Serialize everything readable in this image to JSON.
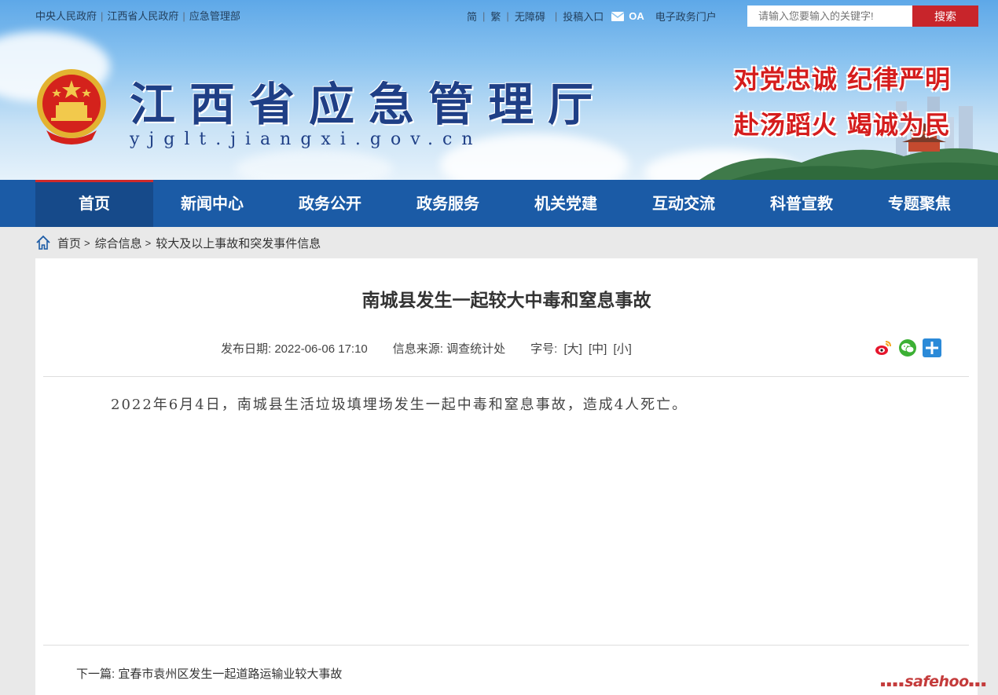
{
  "top_links": [
    "中央人民政府",
    "江西省人民政府",
    "应急管理部"
  ],
  "toolbar": {
    "simplified": "简",
    "traditional": "繁",
    "accessibility": "无障碍",
    "submit": "投稿入口",
    "oa": "OA",
    "egov": "电子政务门户"
  },
  "search": {
    "placeholder": "请输入您要输入的关键字!",
    "button": "搜索"
  },
  "site": {
    "title": "江西省应急管理厅",
    "domain": "yjglt.jiangxi.gov.cn",
    "slogan1": "对党忠诚 纪律严明",
    "slogan2": "赴汤蹈火 竭诚为民"
  },
  "nav": {
    "items": [
      "首页",
      "新闻中心",
      "政务公开",
      "政务服务",
      "机关党建",
      "互动交流",
      "科普宣教",
      "专题聚焦"
    ],
    "active_index": 0
  },
  "breadcrumb": {
    "home": "首页",
    "level1": "综合信息",
    "level2": "较大及以上事故和突发事件信息",
    "separator": ">"
  },
  "article": {
    "title": "南城县发生一起较大中毒和窒息事故",
    "date_label": "发布日期:",
    "date": "2022-06-06 17:10",
    "source_label": "信息来源:",
    "source": "调查统计处",
    "fontsize_label": "字号:",
    "font_large": "[大]",
    "font_medium": "[中]",
    "font_small": "[小]",
    "body": "2022年6月4日，南城县生活垃圾填埋场发生一起中毒和窒息事故，造成4人死亡。"
  },
  "next_article": {
    "label": "下一篇:",
    "title": "宜春市袁州区发生一起道路运输业较大事故"
  },
  "share_icons": [
    "weibo-icon",
    "wechat-icon",
    "more-share-icon"
  ],
  "watermark": "safehoo",
  "colors": {
    "nav_bg": "#1b5ba6",
    "accent_red": "#c8252b",
    "title_blue": "#1f3f86"
  }
}
